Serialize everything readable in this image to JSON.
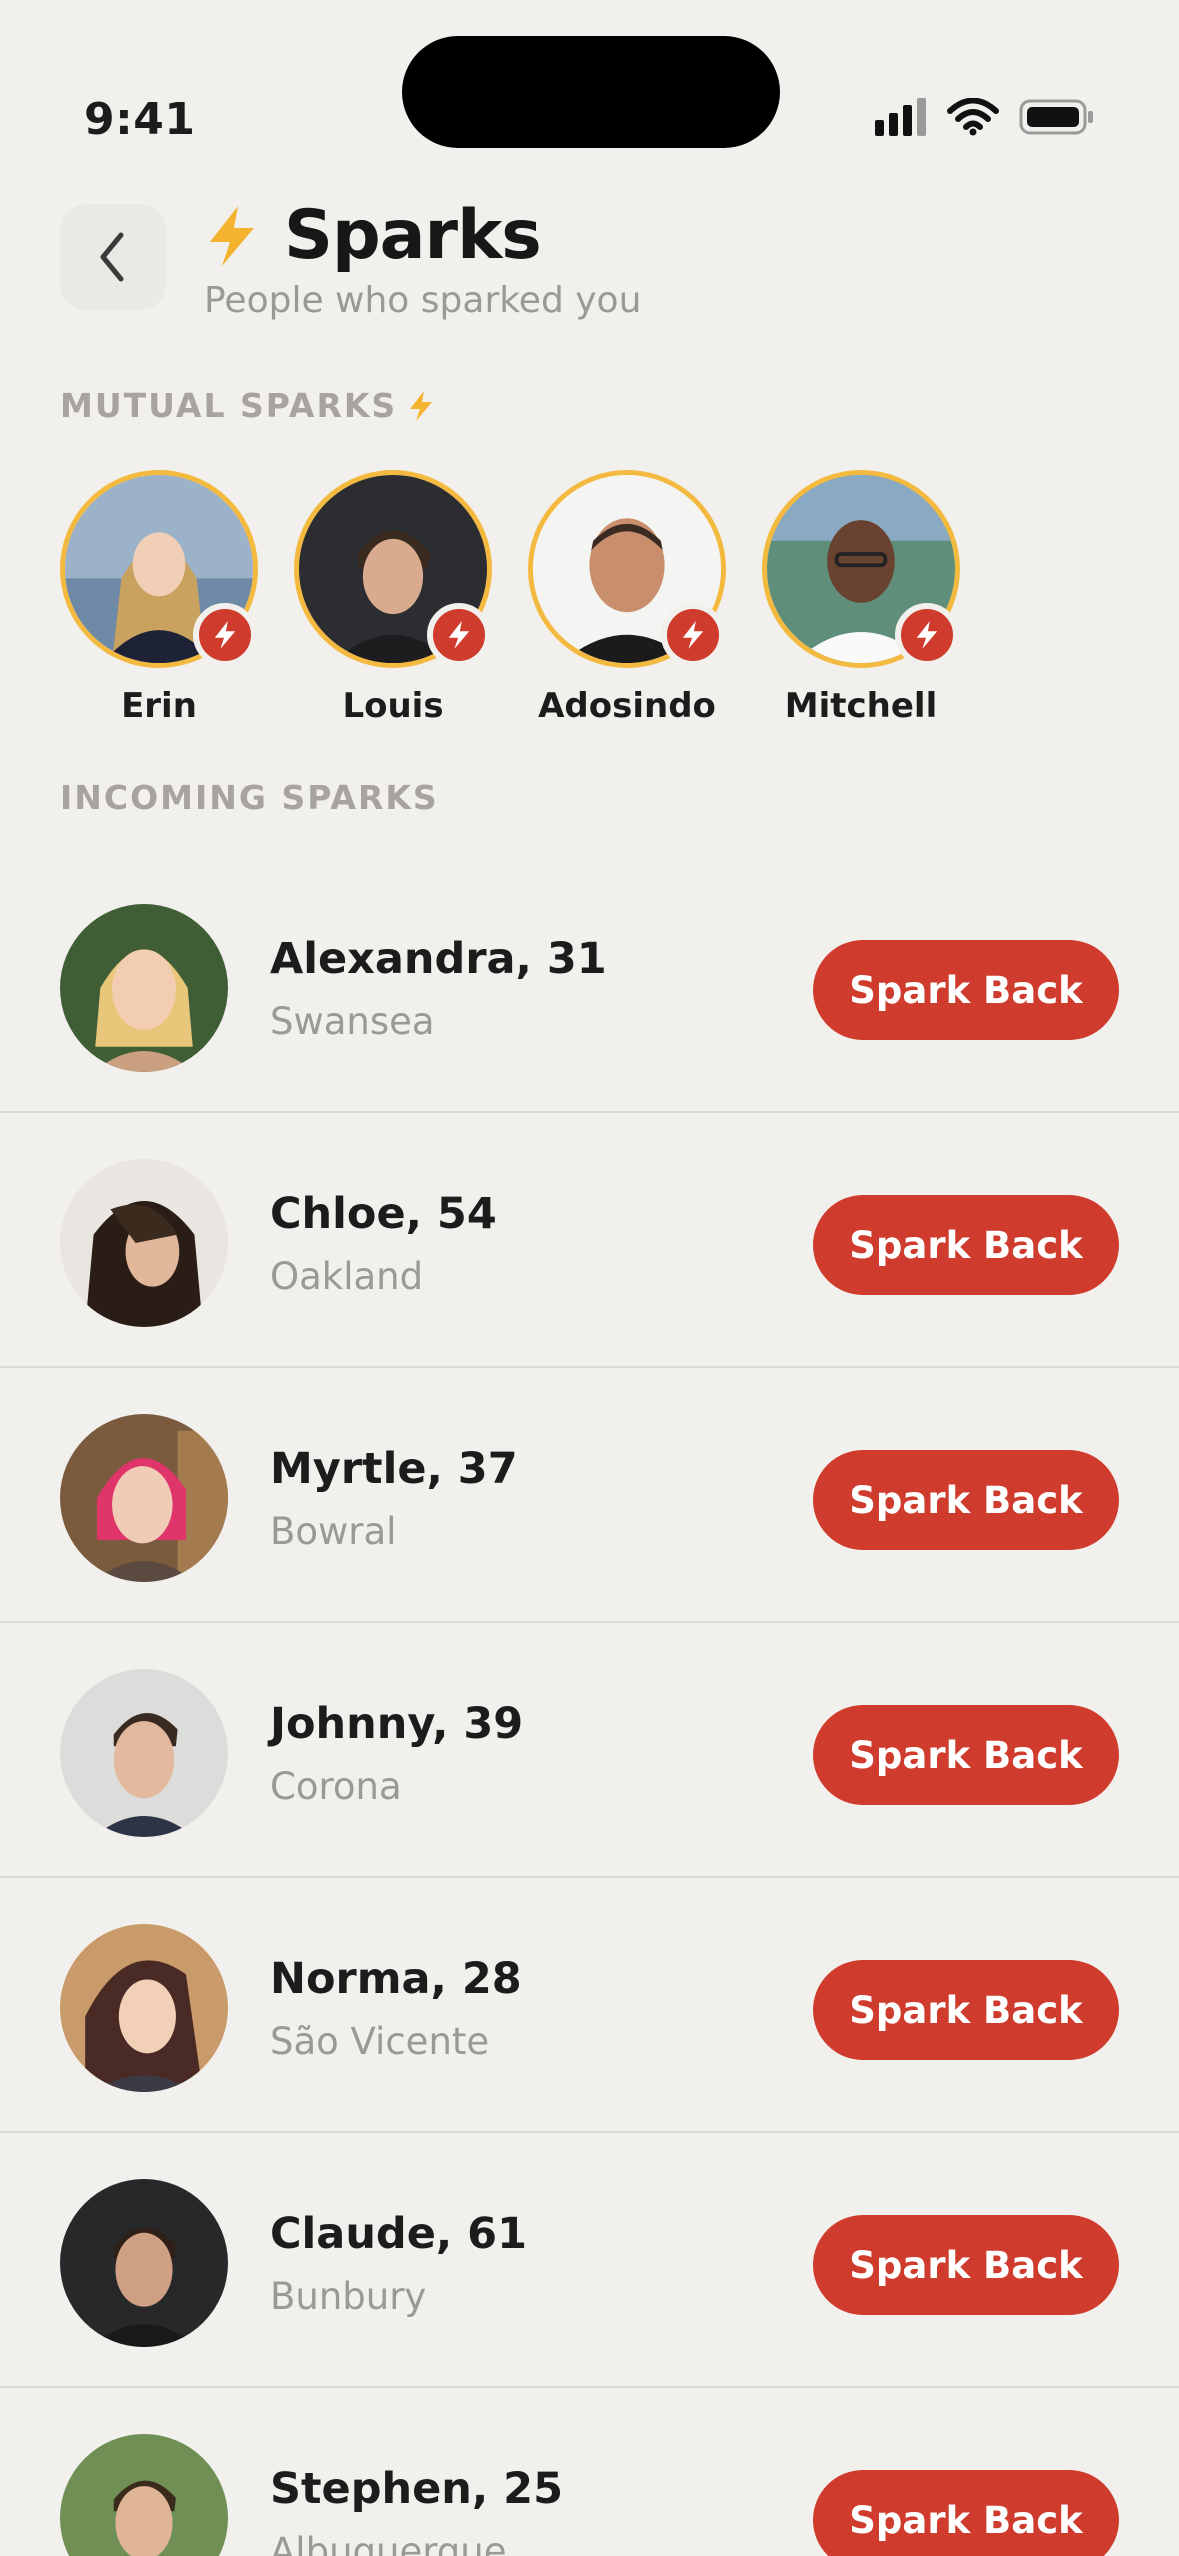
{
  "status_bar": {
    "time": "9:41"
  },
  "header": {
    "title": "Sparks",
    "subtitle": "People who sparked you"
  },
  "mutual": {
    "label": "MUTUAL SPARKS",
    "people": [
      {
        "name": "Erin"
      },
      {
        "name": "Louis"
      },
      {
        "name": "Adosindo"
      },
      {
        "name": "Mitchell"
      }
    ]
  },
  "incoming": {
    "label": "INCOMING SPARKS",
    "button_label": "Spark Back",
    "people": [
      {
        "name": "Alexandra, 31",
        "city": "Swansea"
      },
      {
        "name": "Chloe, 54",
        "city": "Oakland"
      },
      {
        "name": "Myrtle, 37",
        "city": "Bowral"
      },
      {
        "name": "Johnny, 39",
        "city": "Corona"
      },
      {
        "name": "Norma, 28",
        "city": "São Vicente"
      },
      {
        "name": "Claude, 61",
        "city": "Bunbury"
      },
      {
        "name": "Stephen, 25",
        "city": "Albuquerque"
      }
    ]
  },
  "colors": {
    "background": "#f2f0ec",
    "accent_red": "#cf3b2c",
    "ring_gold": "#f4b93f",
    "bolt_yellow": "#f3b32e",
    "muted_text": "#9b9995"
  }
}
